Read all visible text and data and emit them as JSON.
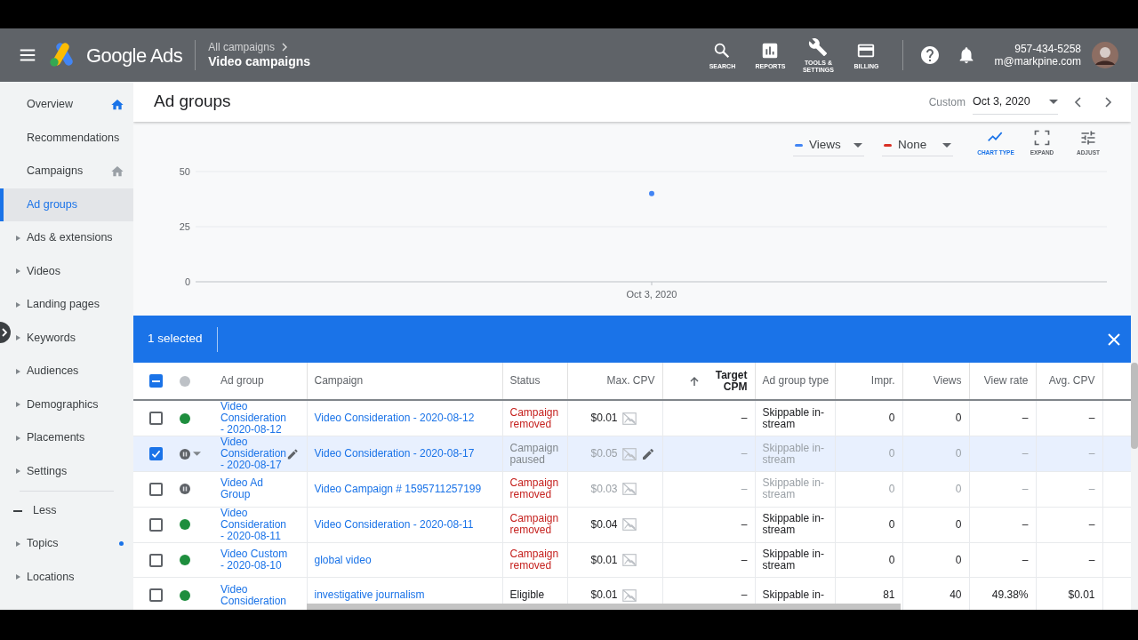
{
  "header": {
    "product": "Google Ads",
    "breadcrumb_parent": "All campaigns",
    "breadcrumb_current": "Video campaigns",
    "tools": [
      {
        "label": "SEARCH",
        "kind": "search"
      },
      {
        "label": "REPORTS",
        "kind": "reports"
      },
      {
        "label": "TOOLS &\nSETTINGS",
        "kind": "tools"
      },
      {
        "label": "BILLING",
        "kind": "billing"
      }
    ],
    "account": {
      "phone": "957-434-5258",
      "email": "m@markpine.com"
    }
  },
  "sidebar": {
    "items": [
      {
        "label": "Overview",
        "kind": "home-active",
        "selected": false
      },
      {
        "label": "Recommendations",
        "kind": "plain",
        "selected": false
      },
      {
        "label": "Campaigns",
        "kind": "home",
        "selected": false
      },
      {
        "label": "Ad groups",
        "kind": "plain",
        "selected": true
      },
      {
        "label": "Ads & extensions",
        "kind": "expand",
        "selected": false
      },
      {
        "label": "Videos",
        "kind": "expand",
        "selected": false
      },
      {
        "label": "Landing pages",
        "kind": "expand",
        "selected": false
      },
      {
        "label": "Keywords",
        "kind": "expand",
        "selected": false
      },
      {
        "label": "Audiences",
        "kind": "expand",
        "selected": false
      },
      {
        "label": "Demographics",
        "kind": "expand",
        "selected": false
      },
      {
        "label": "Placements",
        "kind": "expand",
        "selected": false
      },
      {
        "label": "Settings",
        "kind": "expand",
        "selected": false
      }
    ],
    "less_toggle": "Less",
    "more_items": [
      {
        "label": "Topics",
        "kind": "expand-dot",
        "selected": false
      },
      {
        "label": "Locations",
        "kind": "expand",
        "selected": false
      }
    ]
  },
  "page": {
    "title": "Ad groups",
    "date_label": "Custom",
    "date": "Oct 3, 2020"
  },
  "chart_controls": {
    "secondary_metric": {
      "label": "None",
      "color": "#d93025"
    },
    "actions": [
      {
        "label": "CHART TYPE",
        "kind": "chart",
        "selected": true
      },
      {
        "label": "EXPAND",
        "kind": "expand",
        "selected": false
      },
      {
        "label": "ADJUST",
        "kind": "adjust",
        "selected": false
      }
    ]
  },
  "chart_data": {
    "type": "line",
    "categories": [
      "Oct 3, 2020"
    ],
    "series": [
      {
        "name": "Views",
        "color": "#4285f4",
        "marker": "circle",
        "values": [
          40
        ]
      }
    ],
    "ylim": [
      0,
      50
    ],
    "yticks": [
      0,
      25,
      50
    ]
  },
  "selection_bar": {
    "text": "1 selected"
  },
  "table": {
    "header_checkbox": {
      "indeterminate": true
    },
    "columns": [
      {
        "label": "Ad group",
        "sorted": false
      },
      {
        "label": "Campaign",
        "sorted": false
      },
      {
        "label": "Status",
        "sorted": false
      },
      {
        "label": "Max. CPV",
        "sorted": false
      },
      {
        "label": "Target CPM",
        "sorted": true
      },
      {
        "label": "Ad group type",
        "sorted": false
      },
      {
        "label": "Impr.",
        "sorted": false
      },
      {
        "label": "Views",
        "sorted": false
      },
      {
        "label": "View rate",
        "sorted": false
      },
      {
        "label": "Avg. CPV",
        "sorted": false
      }
    ],
    "rows": [
      {
        "selected": false,
        "hovered": false,
        "dimmed": false,
        "dot": {
          "kind": "enabled"
        },
        "ad_group": "Video Consideration - 2020-08-12",
        "campaign": "Video Consideration - 2020-08-12",
        "status": {
          "text": "Campaign removed",
          "kind": "removed"
        },
        "max_cpv": "$0.01",
        "target_cpm": "–",
        "ad_group_type": "Skippable in-stream",
        "impr": "0",
        "views": "0",
        "view_rate": "–",
        "avg_cpv": "–"
      },
      {
        "selected": true,
        "hovered": true,
        "dimmed": true,
        "dot": {
          "kind": "paused"
        },
        "ad_group": "Video Consideration - 2020-08-17",
        "campaign": "Video Consideration - 2020-08-17",
        "status": {
          "text": "Campaign paused",
          "kind": "paused"
        },
        "max_cpv": "$0.05",
        "target_cpm": "–",
        "ad_group_type": "Skippable in-stream",
        "impr": "0",
        "views": "0",
        "view_rate": "–",
        "avg_cpv": "–"
      },
      {
        "selected": false,
        "hovered": false,
        "dimmed": true,
        "dot": {
          "kind": "paused"
        },
        "ad_group": "Video Ad Group",
        "campaign": "Video Campaign # 1595711257199",
        "status": {
          "text": "Campaign removed",
          "kind": "removed"
        },
        "max_cpv": "$0.03",
        "target_cpm": "–",
        "ad_group_type": "Skippable in-stream",
        "impr": "0",
        "views": "0",
        "view_rate": "–",
        "avg_cpv": "–"
      },
      {
        "selected": false,
        "hovered": false,
        "dimmed": false,
        "dot": {
          "kind": "enabled"
        },
        "ad_group": "Video Consideration - 2020-08-11",
        "campaign": "Video Consideration - 2020-08-11",
        "status": {
          "text": "Campaign removed",
          "kind": "removed"
        },
        "max_cpv": "$0.04",
        "target_cpm": "–",
        "ad_group_type": "Skippable in-stream",
        "impr": "0",
        "views": "0",
        "view_rate": "–",
        "avg_cpv": "–"
      },
      {
        "selected": false,
        "hovered": false,
        "dimmed": false,
        "dot": {
          "kind": "enabled"
        },
        "ad_group": "Video Custom - 2020-08-10",
        "campaign": "global video",
        "status": {
          "text": "Campaign removed",
          "kind": "removed"
        },
        "max_cpv": "$0.01",
        "target_cpm": "–",
        "ad_group_type": "Skippable in-stream",
        "impr": "0",
        "views": "0",
        "view_rate": "–",
        "avg_cpv": "–"
      },
      {
        "selected": false,
        "hovered": false,
        "dimmed": false,
        "dot": {
          "kind": "enabled"
        },
        "ad_group": "Video Consideration",
        "campaign": "investigative journalism",
        "status": {
          "text": "Eligible",
          "kind": "eligible"
        },
        "max_cpv": "$0.01",
        "target_cpm": "–",
        "ad_group_type": "Skippable in-",
        "impr": "81",
        "views": "40",
        "view_rate": "49.38%",
        "avg_cpv": "$0.01"
      }
    ]
  }
}
